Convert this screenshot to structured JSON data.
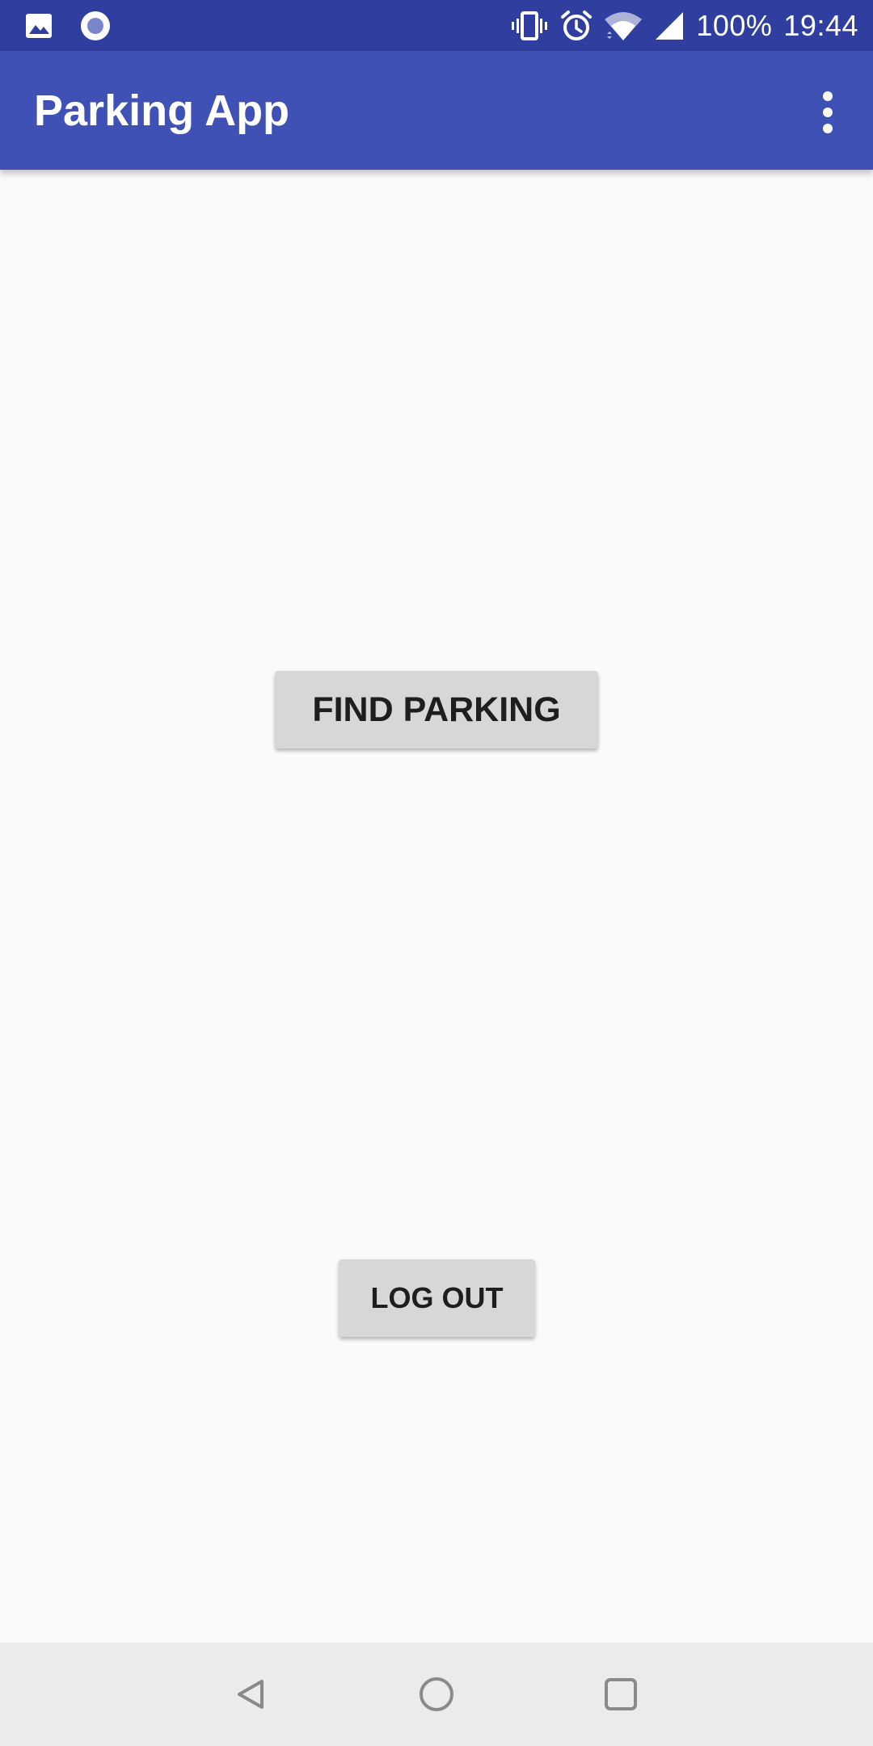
{
  "status_bar": {
    "battery_text": "100%",
    "time": "19:44",
    "left_icons": [
      "image-notification-icon",
      "record-notification-icon"
    ],
    "right_icons": [
      "vibrate-icon",
      "alarm-icon",
      "wifi-icon",
      "cell-signal-icon"
    ],
    "background": "#303f9f"
  },
  "app_bar": {
    "title": "Parking App",
    "background": "#3f51b5",
    "menu_icon": "more-vert-icon"
  },
  "main": {
    "find_parking_label": "FIND PARKING",
    "logout_label": "LOG OUT",
    "button_color": "#d6d7d7"
  },
  "nav_bar": {
    "icons": [
      "back-icon",
      "home-icon",
      "recents-icon"
    ],
    "background": "#ebebeb"
  }
}
